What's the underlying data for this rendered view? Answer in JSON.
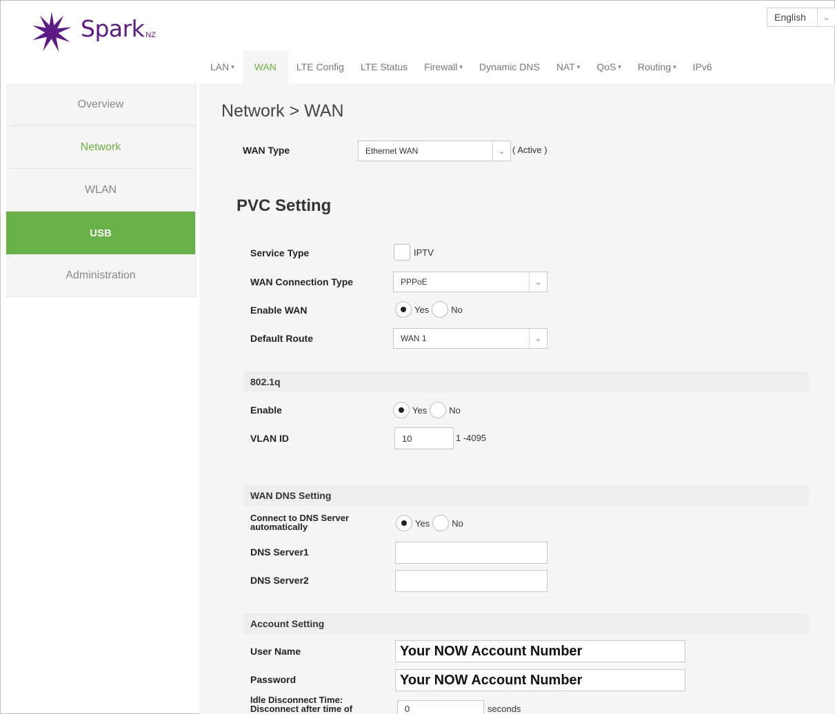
{
  "brand": {
    "name": "Spark",
    "suffix": "NZ"
  },
  "language": {
    "value": "English"
  },
  "topnav": [
    {
      "label": "LAN",
      "dropdown": true,
      "active": false
    },
    {
      "label": "WAN",
      "dropdown": false,
      "active": true
    },
    {
      "label": "LTE Config",
      "dropdown": false,
      "active": false
    },
    {
      "label": "LTE Status",
      "dropdown": false,
      "active": false
    },
    {
      "label": "Firewall",
      "dropdown": true,
      "active": false
    },
    {
      "label": "Dynamic DNS",
      "dropdown": false,
      "active": false
    },
    {
      "label": "NAT",
      "dropdown": true,
      "active": false
    },
    {
      "label": "QoS",
      "dropdown": true,
      "active": false
    },
    {
      "label": "Routing",
      "dropdown": true,
      "active": false
    },
    {
      "label": "IPv6",
      "dropdown": false,
      "active": false
    }
  ],
  "sidebar": [
    {
      "label": "Overview",
      "state": "normal"
    },
    {
      "label": "Network",
      "state": "current"
    },
    {
      "label": "WLAN",
      "state": "normal"
    },
    {
      "label": "USB",
      "state": "active"
    },
    {
      "label": "Administration",
      "state": "normal"
    }
  ],
  "breadcrumb": "Network > WAN",
  "wan_type": {
    "label": "WAN Type",
    "value": "Ethernet WAN",
    "status": "( Active )"
  },
  "pvc": {
    "title": "PVC Setting",
    "service_type": {
      "label": "Service Type",
      "option": "IPTV"
    },
    "connection_type": {
      "label": "WAN Connection Type",
      "value": "PPPoE"
    },
    "enable_wan": {
      "label": "Enable WAN",
      "yes": "Yes",
      "no": "No",
      "selected": "yes"
    },
    "default_route": {
      "label": "Default Route",
      "value": "WAN 1"
    }
  },
  "vlan": {
    "heading": "802.1q",
    "enable": {
      "label": "Enable",
      "yes": "Yes",
      "no": "No",
      "selected": "yes"
    },
    "vlan_id": {
      "label": "VLAN ID",
      "value": "10",
      "range": "1 -4095"
    }
  },
  "dns": {
    "heading": "WAN DNS Setting",
    "auto": {
      "label_line1": "Connect to DNS Server",
      "label_line2": "automatically",
      "yes": "Yes",
      "no": "No",
      "selected": "yes"
    },
    "server1": {
      "label": "DNS Server1",
      "value": ""
    },
    "server2": {
      "label": "DNS Server2",
      "value": ""
    }
  },
  "account": {
    "heading": "Account Setting",
    "username": {
      "label": "User Name",
      "value": "Your NOW Account Number"
    },
    "password": {
      "label": "Password",
      "value": "Your NOW Account Number"
    },
    "idle": {
      "label_line1": "Idle Disconnect Time:",
      "label_line2": "Disconnect after time of",
      "value": "0",
      "unit": "seconds"
    }
  },
  "colors": {
    "brand_purple": "#5b1a86",
    "accent_green": "#67b146",
    "panel_bg": "#f5f5f5"
  }
}
